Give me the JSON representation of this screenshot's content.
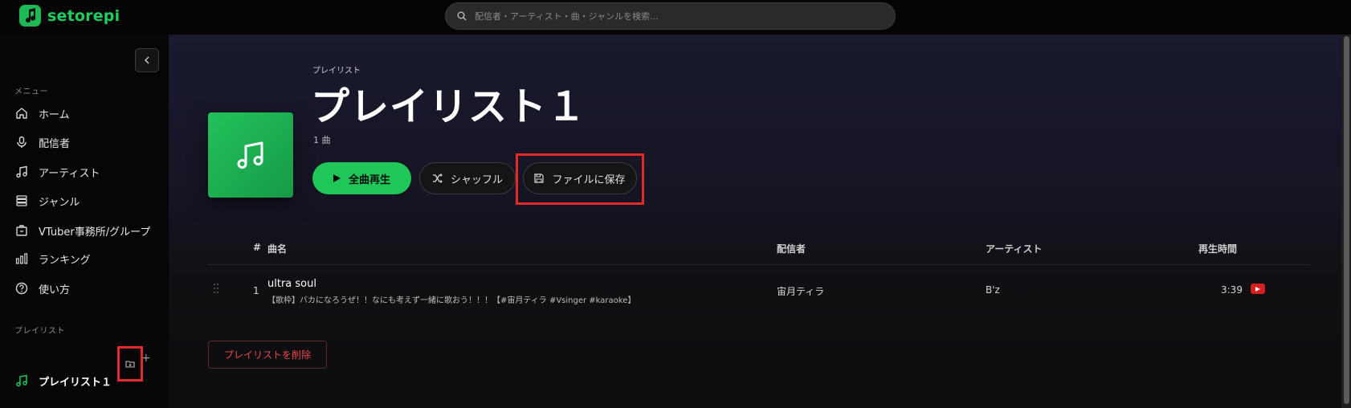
{
  "app": {
    "name": "setorepi"
  },
  "search": {
    "placeholder": "配信者・アーティスト・曲・ジャンルを検索..."
  },
  "sidebar": {
    "menu_label": "メニュー",
    "items": [
      {
        "label": "ホーム",
        "icon": "home-icon"
      },
      {
        "label": "配信者",
        "icon": "microphone-icon"
      },
      {
        "label": "アーティスト",
        "icon": "music-note-icon"
      },
      {
        "label": "ジャンル",
        "icon": "layers-icon"
      },
      {
        "label": "VTuber事務所/グループ",
        "icon": "building-icon"
      },
      {
        "label": "ランキング",
        "icon": "bar-chart-icon"
      },
      {
        "label": "使い方",
        "icon": "help-icon"
      }
    ],
    "playlist_label": "プレイリスト",
    "plus": "+",
    "playlists": [
      {
        "label": "プレイリスト１",
        "icon": "music-note-icon"
      }
    ]
  },
  "playlist": {
    "kind": "プレイリスト",
    "title": "プレイリスト１",
    "count": "1 曲",
    "play_all": "全曲再生",
    "shuffle": "シャッフル",
    "save_to_file": "ファイルに保存",
    "delete": "プレイリストを削除"
  },
  "table": {
    "columns": {
      "num": "#",
      "title": "曲名",
      "streamer": "配信者",
      "artist": "アーティスト",
      "duration": "再生時間"
    },
    "rows": [
      {
        "num": "1",
        "title": "ultra soul",
        "subtitle": "【歌枠】バカになろうぜ！！なにも考えず一緒に歌おう！！！【#宙月ティラ #Vsinger #karaoke】",
        "streamer": "宙月ティラ",
        "artist": "B'z",
        "duration": "3:39"
      }
    ]
  },
  "colors": {
    "accent": "#1ec758",
    "danger": "#e84a4a",
    "highlight": "#e22a2a"
  }
}
